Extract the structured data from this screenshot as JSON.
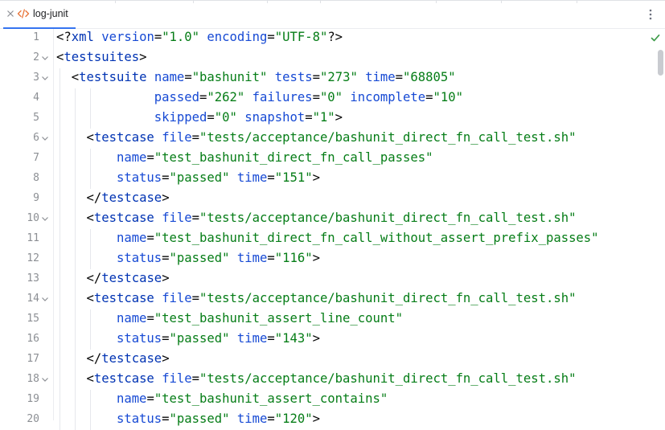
{
  "tab": {
    "label": "log-junit"
  },
  "lines": [
    {
      "num": "1",
      "fold": false,
      "indent": 0,
      "tokens": [
        [
          "punct",
          "<?"
        ],
        [
          "tag",
          "xml"
        ],
        [
          "punct",
          " "
        ],
        [
          "attr",
          "version"
        ],
        [
          "punct",
          "="
        ],
        [
          "val",
          "\"1.0\""
        ],
        [
          "punct",
          " "
        ],
        [
          "attr",
          "encoding"
        ],
        [
          "punct",
          "="
        ],
        [
          "val",
          "\"UTF-8\""
        ],
        [
          "punct",
          "?>"
        ]
      ]
    },
    {
      "num": "2",
      "fold": true,
      "indent": 0,
      "tokens": [
        [
          "punct",
          "<"
        ],
        [
          "tag",
          "testsuites"
        ],
        [
          "punct",
          ">"
        ]
      ]
    },
    {
      "num": "3",
      "fold": true,
      "indent": 2,
      "tokens": [
        [
          "punct",
          "<"
        ],
        [
          "tag",
          "testsuite"
        ],
        [
          "punct",
          " "
        ],
        [
          "attr",
          "name"
        ],
        [
          "punct",
          "="
        ],
        [
          "val",
          "\"bashunit\""
        ],
        [
          "punct",
          " "
        ],
        [
          "attr",
          "tests"
        ],
        [
          "punct",
          "="
        ],
        [
          "val",
          "\"273\""
        ],
        [
          "punct",
          " "
        ],
        [
          "attr",
          "time"
        ],
        [
          "punct",
          "="
        ],
        [
          "val",
          "\"68805\""
        ]
      ]
    },
    {
      "num": "4",
      "fold": false,
      "indent": 13,
      "tokens": [
        [
          "attr",
          "passed"
        ],
        [
          "punct",
          "="
        ],
        [
          "val",
          "\"262\""
        ],
        [
          "punct",
          " "
        ],
        [
          "attr",
          "failures"
        ],
        [
          "punct",
          "="
        ],
        [
          "val",
          "\"0\""
        ],
        [
          "punct",
          " "
        ],
        [
          "attr",
          "incomplete"
        ],
        [
          "punct",
          "="
        ],
        [
          "val",
          "\"10\""
        ]
      ]
    },
    {
      "num": "5",
      "fold": false,
      "indent": 13,
      "tokens": [
        [
          "attr",
          "skipped"
        ],
        [
          "punct",
          "="
        ],
        [
          "val",
          "\"0\""
        ],
        [
          "punct",
          " "
        ],
        [
          "attr",
          "snapshot"
        ],
        [
          "punct",
          "="
        ],
        [
          "val",
          "\"1\""
        ],
        [
          "punct",
          ">"
        ]
      ]
    },
    {
      "num": "6",
      "fold": true,
      "indent": 4,
      "tokens": [
        [
          "punct",
          "<"
        ],
        [
          "tag",
          "testcase"
        ],
        [
          "punct",
          " "
        ],
        [
          "attr",
          "file"
        ],
        [
          "punct",
          "="
        ],
        [
          "val",
          "\"tests/acceptance/bashunit_direct_fn_call_test.sh\""
        ]
      ]
    },
    {
      "num": "7",
      "fold": false,
      "indent": 8,
      "tokens": [
        [
          "attr",
          "name"
        ],
        [
          "punct",
          "="
        ],
        [
          "val",
          "\"test_bashunit_direct_fn_call_passes\""
        ]
      ]
    },
    {
      "num": "8",
      "fold": false,
      "indent": 8,
      "tokens": [
        [
          "attr",
          "status"
        ],
        [
          "punct",
          "="
        ],
        [
          "val",
          "\"passed\""
        ],
        [
          "punct",
          " "
        ],
        [
          "attr",
          "time"
        ],
        [
          "punct",
          "="
        ],
        [
          "val",
          "\"151\""
        ],
        [
          "punct",
          ">"
        ]
      ]
    },
    {
      "num": "9",
      "fold": false,
      "indent": 4,
      "tokens": [
        [
          "punct",
          "</"
        ],
        [
          "tag",
          "testcase"
        ],
        [
          "punct",
          ">"
        ]
      ]
    },
    {
      "num": "10",
      "fold": true,
      "indent": 4,
      "tokens": [
        [
          "punct",
          "<"
        ],
        [
          "tag",
          "testcase"
        ],
        [
          "punct",
          " "
        ],
        [
          "attr",
          "file"
        ],
        [
          "punct",
          "="
        ],
        [
          "val",
          "\"tests/acceptance/bashunit_direct_fn_call_test.sh\""
        ]
      ]
    },
    {
      "num": "11",
      "fold": false,
      "indent": 8,
      "tokens": [
        [
          "attr",
          "name"
        ],
        [
          "punct",
          "="
        ],
        [
          "val",
          "\"test_bashunit_direct_fn_call_without_assert_prefix_passes\""
        ]
      ]
    },
    {
      "num": "12",
      "fold": false,
      "indent": 8,
      "tokens": [
        [
          "attr",
          "status"
        ],
        [
          "punct",
          "="
        ],
        [
          "val",
          "\"passed\""
        ],
        [
          "punct",
          " "
        ],
        [
          "attr",
          "time"
        ],
        [
          "punct",
          "="
        ],
        [
          "val",
          "\"116\""
        ],
        [
          "punct",
          ">"
        ]
      ]
    },
    {
      "num": "13",
      "fold": false,
      "indent": 4,
      "tokens": [
        [
          "punct",
          "</"
        ],
        [
          "tag",
          "testcase"
        ],
        [
          "punct",
          ">"
        ]
      ]
    },
    {
      "num": "14",
      "fold": true,
      "indent": 4,
      "tokens": [
        [
          "punct",
          "<"
        ],
        [
          "tag",
          "testcase"
        ],
        [
          "punct",
          " "
        ],
        [
          "attr",
          "file"
        ],
        [
          "punct",
          "="
        ],
        [
          "val",
          "\"tests/acceptance/bashunit_direct_fn_call_test.sh\""
        ]
      ]
    },
    {
      "num": "15",
      "fold": false,
      "indent": 8,
      "tokens": [
        [
          "attr",
          "name"
        ],
        [
          "punct",
          "="
        ],
        [
          "val",
          "\"test_bashunit_assert_line_count\""
        ]
      ]
    },
    {
      "num": "16",
      "fold": false,
      "indent": 8,
      "tokens": [
        [
          "attr",
          "status"
        ],
        [
          "punct",
          "="
        ],
        [
          "val",
          "\"passed\""
        ],
        [
          "punct",
          " "
        ],
        [
          "attr",
          "time"
        ],
        [
          "punct",
          "="
        ],
        [
          "val",
          "\"143\""
        ],
        [
          "punct",
          ">"
        ]
      ]
    },
    {
      "num": "17",
      "fold": false,
      "indent": 4,
      "tokens": [
        [
          "punct",
          "</"
        ],
        [
          "tag",
          "testcase"
        ],
        [
          "punct",
          ">"
        ]
      ]
    },
    {
      "num": "18",
      "fold": true,
      "indent": 4,
      "tokens": [
        [
          "punct",
          "<"
        ],
        [
          "tag",
          "testcase"
        ],
        [
          "punct",
          " "
        ],
        [
          "attr",
          "file"
        ],
        [
          "punct",
          "="
        ],
        [
          "val",
          "\"tests/acceptance/bashunit_direct_fn_call_test.sh\""
        ]
      ]
    },
    {
      "num": "19",
      "fold": false,
      "indent": 8,
      "tokens": [
        [
          "attr",
          "name"
        ],
        [
          "punct",
          "="
        ],
        [
          "val",
          "\"test_bashunit_assert_contains\""
        ]
      ]
    },
    {
      "num": "20",
      "fold": false,
      "indent": 8,
      "tokens": [
        [
          "attr",
          "status"
        ],
        [
          "punct",
          "="
        ],
        [
          "val",
          "\"passed\""
        ],
        [
          "punct",
          " "
        ],
        [
          "attr",
          "time"
        ],
        [
          "punct",
          "="
        ],
        [
          "val",
          "\"120\""
        ],
        [
          "punct",
          ">"
        ]
      ]
    }
  ]
}
